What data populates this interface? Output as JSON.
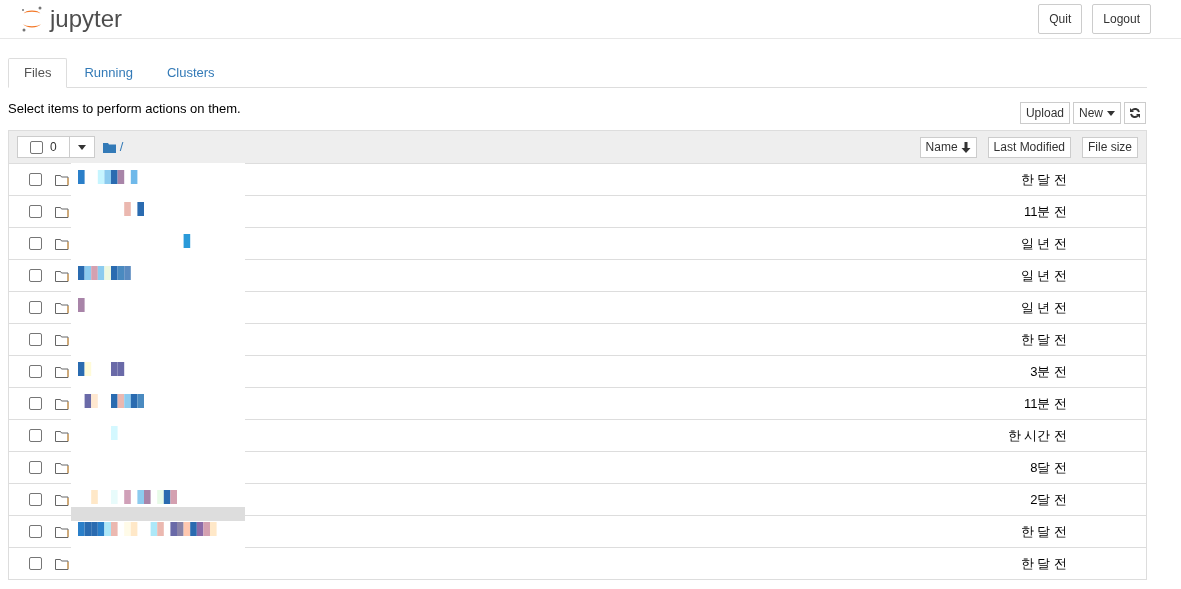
{
  "header": {
    "logo_text": "jupyter",
    "buttons": [
      "Quit",
      "Logout"
    ]
  },
  "tabs": [
    {
      "label": "Files",
      "selected": true
    },
    {
      "label": "Running",
      "selected": false
    },
    {
      "label": "Clusters",
      "selected": false
    }
  ],
  "hint": "Select items to perform actions on them.",
  "toolbar": {
    "buttons": [
      "Upload",
      "New"
    ]
  },
  "list_header": {
    "select_all_checked": false,
    "selected_count": "0",
    "path": "/",
    "sort_buttons": [
      "Name",
      "Last Modified",
      "File size"
    ]
  },
  "rows": [
    {
      "checked": false,
      "modified": "한 달 전"
    },
    {
      "checked": false,
      "modified": "11분 전"
    },
    {
      "checked": false,
      "modified": "일 년 전"
    },
    {
      "checked": false,
      "modified": "일 년 전"
    },
    {
      "checked": false,
      "modified": "일 년 전"
    },
    {
      "checked": false,
      "modified": "한 달 전"
    },
    {
      "checked": false,
      "modified": "3분 전"
    },
    {
      "checked": false,
      "modified": "11분 전"
    },
    {
      "checked": false,
      "modified": "한 시간 전"
    },
    {
      "checked": false,
      "modified": "8달 전"
    },
    {
      "checked": false,
      "modified": "2달 전"
    },
    {
      "checked": false,
      "modified": "한 달 전"
    },
    {
      "checked": false,
      "modified": "한 달 전"
    }
  ]
}
